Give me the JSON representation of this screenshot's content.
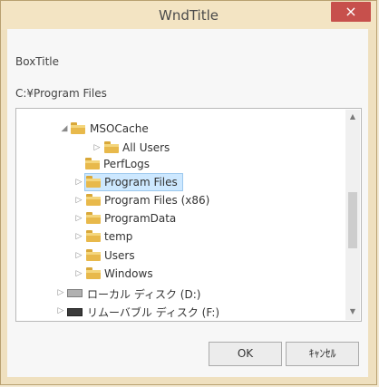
{
  "window": {
    "title": "WndTitle",
    "close_glyph": "×"
  },
  "dialog": {
    "box_title": "BoxTitle",
    "current_path": "C:¥Program Files"
  },
  "tree": {
    "items": [
      {
        "label": "MSOCache",
        "expander": "◢",
        "type": "folder"
      },
      {
        "label": "All Users",
        "expander": "▷",
        "type": "folder"
      },
      {
        "label": "PerfLogs",
        "expander": "",
        "type": "folder"
      },
      {
        "label": "Program Files",
        "expander": "▷",
        "type": "folder",
        "selected": true
      },
      {
        "label": "Program Files (x86)",
        "expander": "▷",
        "type": "folder"
      },
      {
        "label": "ProgramData",
        "expander": "▷",
        "type": "folder"
      },
      {
        "label": "temp",
        "expander": "▷",
        "type": "folder"
      },
      {
        "label": "Users",
        "expander": "▷",
        "type": "folder"
      },
      {
        "label": "Windows",
        "expander": "▷",
        "type": "folder"
      },
      {
        "label": "ローカル ディスク (D:)",
        "expander": "▷",
        "type": "drive"
      },
      {
        "label": "リムーバブル ディスク (F:)",
        "expander": "▷",
        "type": "drive"
      }
    ]
  },
  "buttons": {
    "ok": "OK",
    "cancel": "ｷｬﾝｾﾙ"
  },
  "icons": {
    "scroll_up": "scroll-up-arrow-icon",
    "scroll_down": "scroll-down-arrow-icon"
  },
  "colors": {
    "titlebar": "#f3e4c3",
    "close_button": "#c7504c",
    "selection": "#cde8ff",
    "folder": "#e8b94b"
  }
}
